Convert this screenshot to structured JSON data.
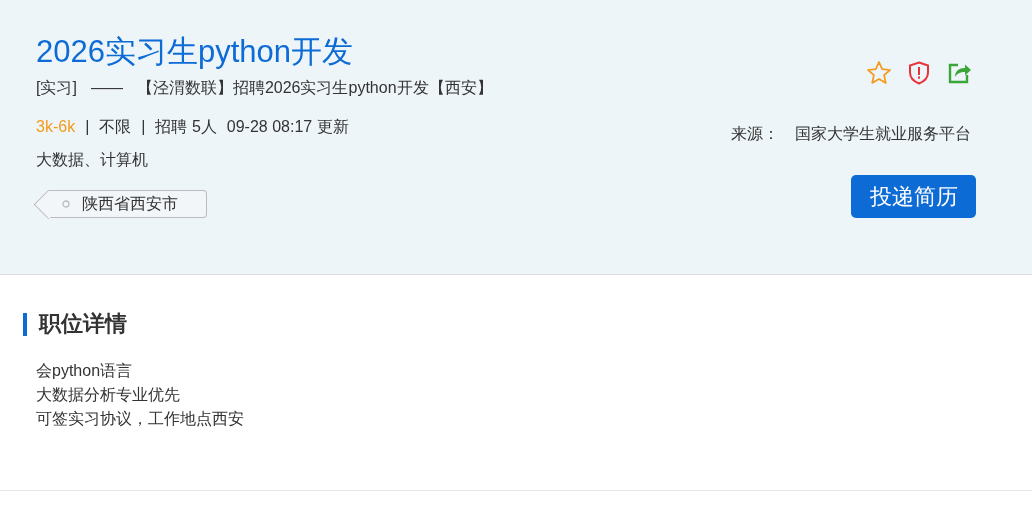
{
  "job": {
    "title": "2026实习生python开发",
    "subtitle": [
      "[实习]",
      "——",
      "【泾渭数联】招聘2026实习生python开发【西安】"
    ],
    "meta": [
      {
        "kind": "salary",
        "text": "3k-6k"
      },
      {
        "kind": "separator",
        "text": "|"
      },
      {
        "kind": "plain",
        "text": "不限"
      },
      {
        "kind": "separator",
        "text": "|"
      },
      {
        "kind": "plain",
        "text": "招聘 5人"
      },
      {
        "kind": "plain",
        "text": "09-28 08:17 更新"
      }
    ],
    "majors": "大数据、计算机",
    "location_tag": "陕西省西安市",
    "source_label": "来源：",
    "source": "国家大学生就业服务平台",
    "apply_button": "投递简历"
  },
  "details": {
    "heading": "职位详情",
    "lines": [
      "会python语言",
      "大数据分析专业优先",
      "可签实习协议，工作地点西安"
    ]
  }
}
